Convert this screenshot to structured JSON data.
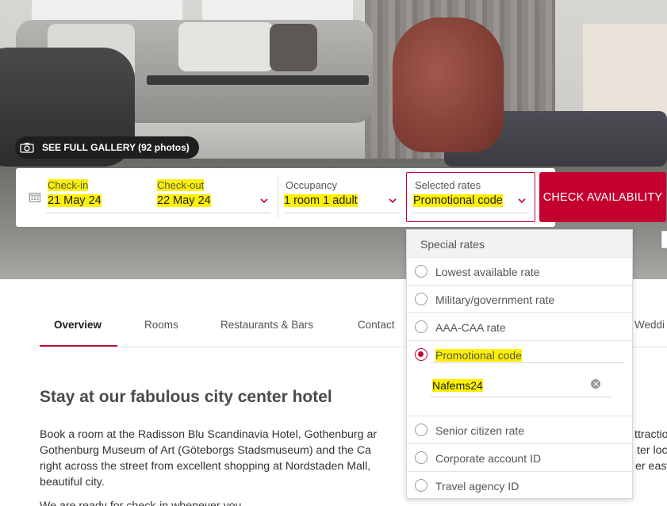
{
  "gallery": {
    "label": "SEE FULL GALLERY (92 photos)"
  },
  "booking": {
    "checkin_label": "Check-in",
    "checkin_value": "21 May 24",
    "checkout_label": "Check-out",
    "checkout_value": "22 May 24",
    "occupancy_label": "Occupancy",
    "occupancy_value": "1 room  1 adult",
    "rates_label": "Selected rates",
    "rates_value": "Promotional code",
    "check_button": "CHECK AVAILABILITY"
  },
  "rates_dropdown": {
    "header": "Special rates",
    "options": [
      {
        "label": "Lowest available rate",
        "selected": false
      },
      {
        "label": "Military/government rate",
        "selected": false
      },
      {
        "label": "AAA-CAA rate",
        "selected": false
      },
      {
        "label": "Promotional code",
        "selected": true
      },
      {
        "label": "Senior citizen rate",
        "selected": false
      },
      {
        "label": "Corporate account ID",
        "selected": false
      },
      {
        "label": "Travel agency ID",
        "selected": false
      }
    ],
    "promo_code_value": "Nafems24"
  },
  "tabs": [
    "Overview",
    "Rooms",
    "Restaurants & Bars",
    "Contact",
    "Weddi"
  ],
  "content": {
    "headline": "Stay at our fabulous city center hotel",
    "lines_left": [
      "Book a room at the Radisson Blu Scandinavia Hotel, Gothenburg ar",
      "Gothenburg Museum of Art (Göteborgs Stadsmuseum) and the Ca",
      "right across the street from excellent shopping at Nordstaden Mall,",
      "beautiful city."
    ],
    "lines_right": [
      "ttractio",
      "ter loc",
      "er easy"
    ],
    "cutoff_line": "We are ready for check-in whenever you"
  },
  "colors": {
    "accent": "#c3002f",
    "highlight": "#fdf000"
  }
}
